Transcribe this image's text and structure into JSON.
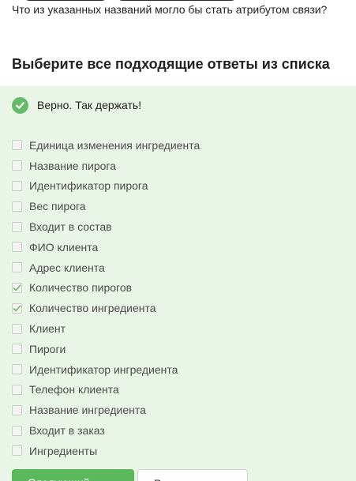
{
  "question": {
    "text": "Что из указанных названий могло бы стать атрибутом связи?"
  },
  "instruction": "Выберите все подходящие ответы из списка",
  "feedback": {
    "icon": "check-circle-icon",
    "text": "Верно. Так держать!",
    "color": "#66bb6a"
  },
  "options": [
    {
      "label": "Единица изменения ингредиента",
      "checked": false
    },
    {
      "label": "Название пирога",
      "checked": false
    },
    {
      "label": "Идентификатор пирога",
      "checked": false
    },
    {
      "label": "Вес пирога",
      "checked": false
    },
    {
      "label": "Входит в состав",
      "checked": false
    },
    {
      "label": "ФИО клиента",
      "checked": false
    },
    {
      "label": "Адрес клиента",
      "checked": false
    },
    {
      "label": "Количество пирогов",
      "checked": true
    },
    {
      "label": "Количество ингредиента",
      "checked": true
    },
    {
      "label": "Клиент",
      "checked": false
    },
    {
      "label": "Пироги",
      "checked": false
    },
    {
      "label": "Идентификатор ингредиента",
      "checked": false
    },
    {
      "label": "Телефон клиента",
      "checked": false
    },
    {
      "label": "Название ингредиента",
      "checked": false
    },
    {
      "label": "Входит в заказ",
      "checked": false
    },
    {
      "label": "Ингредиенты",
      "checked": false
    }
  ],
  "buttons": {
    "primary_label": "Следующий",
    "secondary_label": "Решить снова"
  },
  "colors": {
    "panel_background": "#e9f5e6",
    "accent_green": "#5cb85c"
  }
}
